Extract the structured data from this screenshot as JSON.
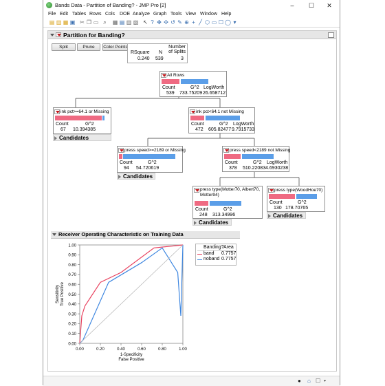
{
  "window": {
    "title": "Bands Data - Partition of Banding? - JMP Pro [2]",
    "minimize": "–",
    "maximize": "☐",
    "close": "✕"
  },
  "menu": [
    "File",
    "Edit",
    "Tables",
    "Rows",
    "Cols",
    "DOE",
    "Analyze",
    "Graph",
    "Tools",
    "View",
    "Window",
    "Help"
  ],
  "report": {
    "title": "Partition for Banding?",
    "buttons": {
      "split": "Split",
      "prune": "Prune",
      "color_points": "Color Points"
    },
    "stats": {
      "rsquare_label": "RSquare",
      "n_label": "N",
      "splits_label": "Number\nof Splits",
      "rsquare": "0.240",
      "n": "539",
      "splits": "3"
    }
  },
  "tree": {
    "all_rows": {
      "title": "All Rows",
      "count_label": "Count",
      "g2_label": "G^2",
      "logworth_label": "LogWorth",
      "count": "539",
      "g2": "733.75209",
      "logworth": "26.658712"
    },
    "ink_hi": {
      "title": "ink pct>=64.1 or Missing",
      "count_label": "Count",
      "g2_label": "G^2",
      "count": "67",
      "g2": "10.394385",
      "candidates": "Candidates"
    },
    "ink_lo": {
      "title": "ink pct<64.1 not Missing",
      "count_label": "Count",
      "g2_label": "G^2",
      "logworth_label": "LogWorth",
      "count": "472",
      "g2": "605.82477",
      "logworth": "9.7915733"
    },
    "press_hi": {
      "title": "press speed>=2189 or Missing",
      "count_label": "Count",
      "g2_label": "G^2",
      "count": "94",
      "g2": "54.720619",
      "candidates": "Candidates"
    },
    "press_lo": {
      "title": "press speed<2189 not Missing",
      "count_label": "Count",
      "g2_label": "G^2",
      "logworth_label": "LogWorth",
      "count": "378",
      "g2": "510.22083",
      "logworth": "4.6930238"
    },
    "ptype_a": {
      "title": "press type(Motter70, Albert70, Motter94)",
      "count_label": "Count",
      "g2_label": "G^2",
      "count": "248",
      "g2": "313.34996",
      "candidates": "Candidates"
    },
    "ptype_b": {
      "title": "press type(WoodHoe70)",
      "count_label": "Count",
      "g2_label": "G^2",
      "count": "130",
      "g2": "178.70765",
      "candidates": "Candidates"
    }
  },
  "roc": {
    "section_title": "Receiver Operating Characteristic on Training Data",
    "legend": {
      "header_var": "Banding?",
      "header_area": "Area",
      "rows": [
        {
          "name": "band",
          "area": "0.7757",
          "color": "#e8415e"
        },
        {
          "name": "noband",
          "area": "0.7757",
          "color": "#3d86e0"
        }
      ]
    }
  },
  "chart_data": {
    "type": "line",
    "title": "",
    "xlabel": "1-Specificity\nFalse Positive",
    "ylabel": "Sensitivity\nTrue Positive",
    "xlim": [
      0,
      1
    ],
    "ylim": [
      0,
      1
    ],
    "xticks": [
      "0.00",
      "0.20",
      "0.40",
      "0.60",
      "0.80",
      "1.00"
    ],
    "yticks": [
      "0.00",
      "0.10",
      "0.20",
      "0.30",
      "0.40",
      "0.50",
      "0.60",
      "0.70",
      "0.80",
      "0.90",
      "1.00"
    ],
    "grid": false,
    "legend_placement": "right",
    "series": [
      {
        "name": "band",
        "color": "#e8415e",
        "x": [
          0,
          0.02,
          0.05,
          0.2,
          0.4,
          0.72,
          1
        ],
        "y": [
          0,
          0.28,
          0.38,
          0.62,
          0.72,
          0.97,
          1
        ]
      },
      {
        "name": "noband",
        "color": "#3d86e0",
        "x": [
          0,
          0.03,
          0.28,
          0.6,
          0.8,
          0.95,
          0.98,
          1
        ],
        "y": [
          0,
          0.03,
          0.62,
          0.82,
          0.97,
          0.72,
          0.28,
          1
        ]
      },
      {
        "name": "",
        "color": "#b5b5b5",
        "x": [
          0,
          1
        ],
        "y": [
          0,
          1
        ]
      }
    ]
  }
}
